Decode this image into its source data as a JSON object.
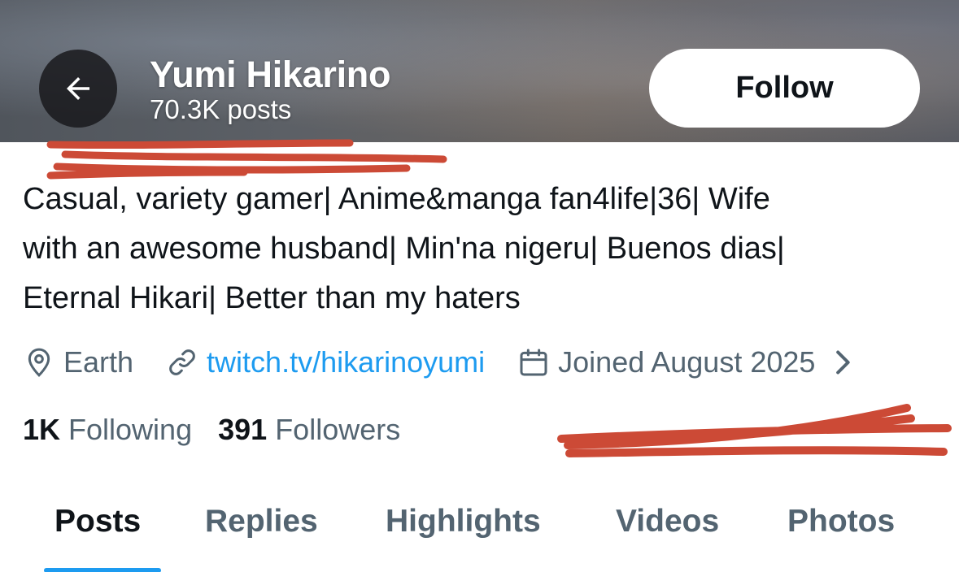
{
  "header": {
    "back_icon": "arrow-left-icon",
    "name": "Yumi Hikarino",
    "post_count": "70.3K posts",
    "follow_label": "Follow"
  },
  "bio": {
    "line1": "Casual, variety gamer| Anime&manga fan4life|36| Wife",
    "line2": "with an awesome husband| Min'na nigeru| Buenos dias|",
    "line3": "Eternal Hikari| Better than my haters"
  },
  "meta": {
    "location_icon": "location-pin-icon",
    "location": "Earth",
    "link_icon": "link-icon",
    "link": "twitch.tv/hikarinoyumi",
    "joined_icon": "calendar-icon",
    "joined": "Joined August 2025",
    "more_icon": "chevron-right-icon"
  },
  "stats": {
    "following_count": "1K",
    "following_label": "Following",
    "followers_count": "391",
    "followers_label": "Followers"
  },
  "tabs": [
    {
      "label": "Posts",
      "active": true
    },
    {
      "label": "Replies",
      "active": false
    },
    {
      "label": "Highlights",
      "active": false
    },
    {
      "label": "Videos",
      "active": false
    },
    {
      "label": "Photos",
      "active": false
    }
  ],
  "colors": {
    "accent": "#1d9bf0",
    "text_primary": "#0f1419",
    "text_secondary": "#536471",
    "redaction": "#cc4a36"
  }
}
